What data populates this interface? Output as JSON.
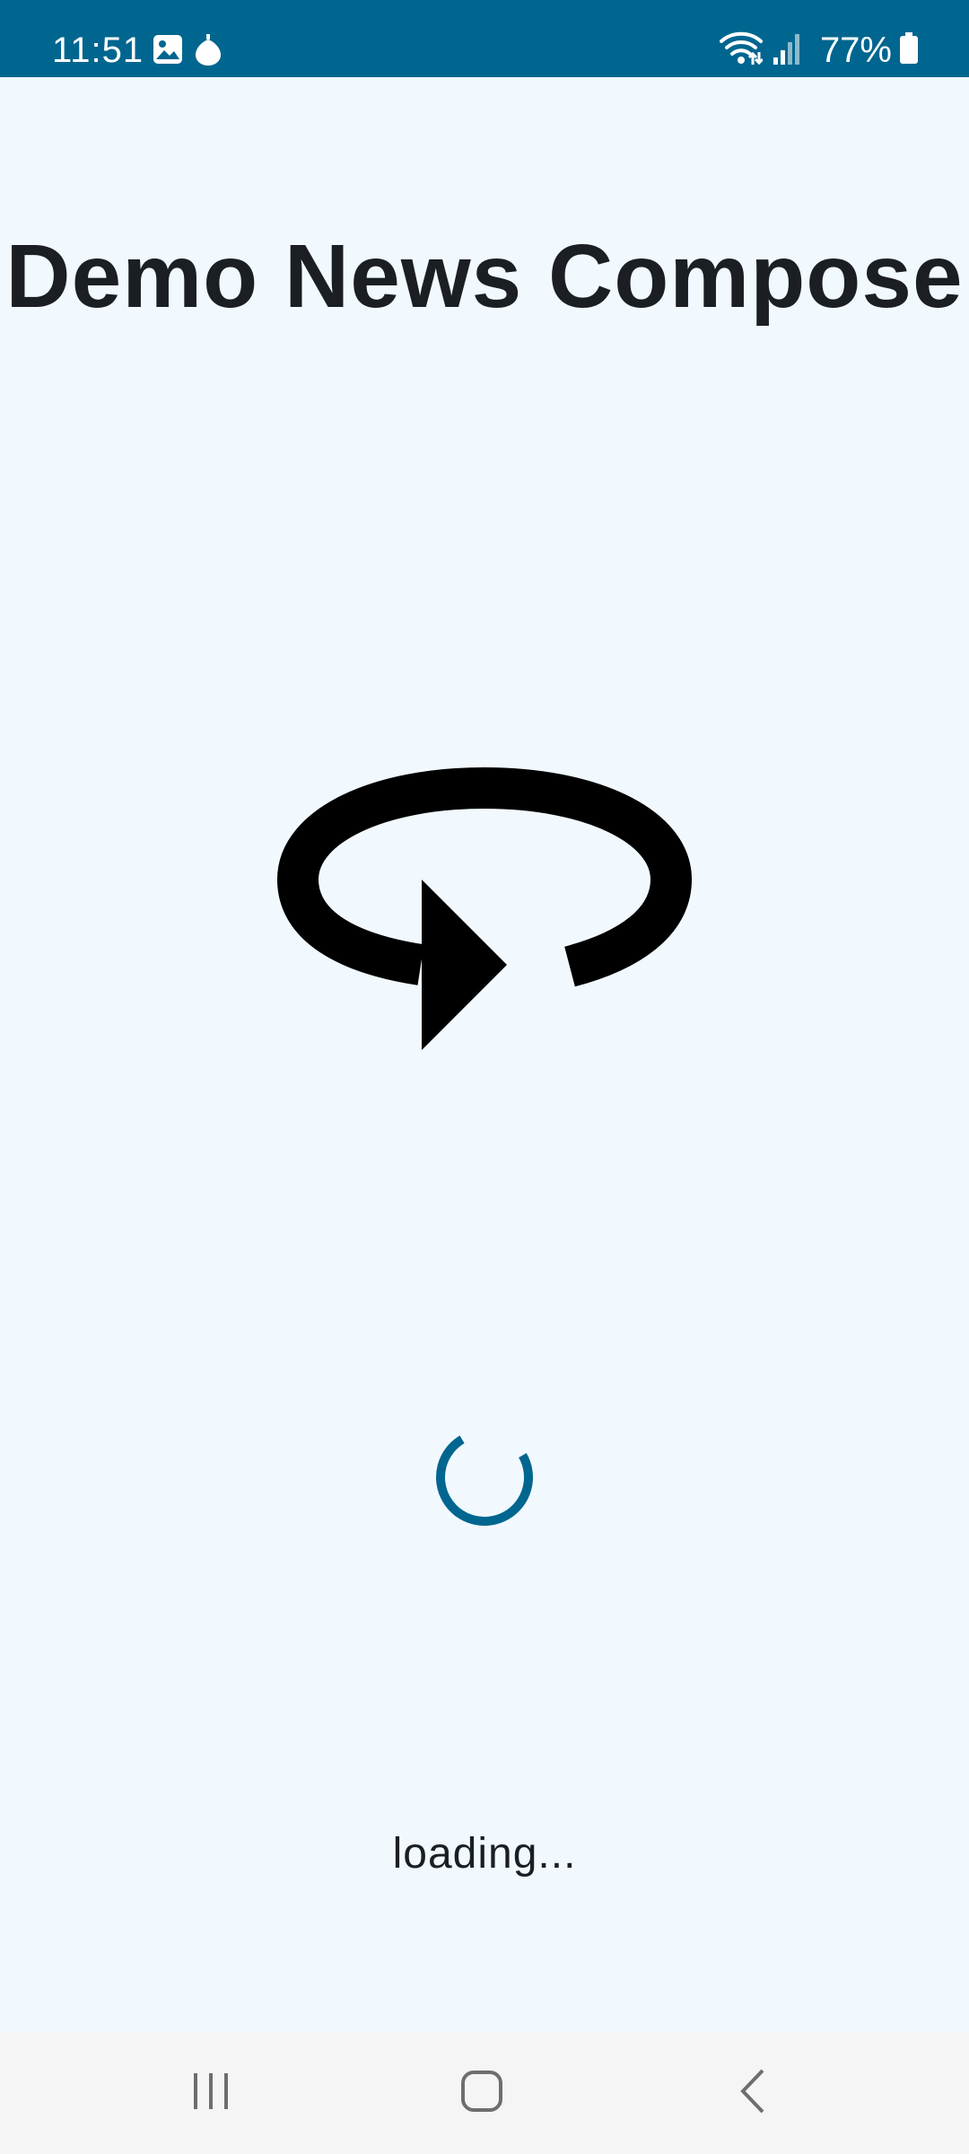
{
  "status_bar": {
    "time": "11:51",
    "battery_percent": "77%",
    "icons": [
      "image-icon",
      "notification-drop-icon",
      "wifi-icon",
      "signal-icon",
      "battery-icon"
    ],
    "background_color": "#00668f"
  },
  "app": {
    "title": "Demo News Compose",
    "center_icon": "refresh-icon",
    "loading_text": "loading...",
    "accent_color": "#00668f",
    "background_color": "#f1f9ff"
  },
  "nav_bar": {
    "buttons": [
      "recent-apps-icon",
      "home-icon",
      "back-icon"
    ]
  }
}
